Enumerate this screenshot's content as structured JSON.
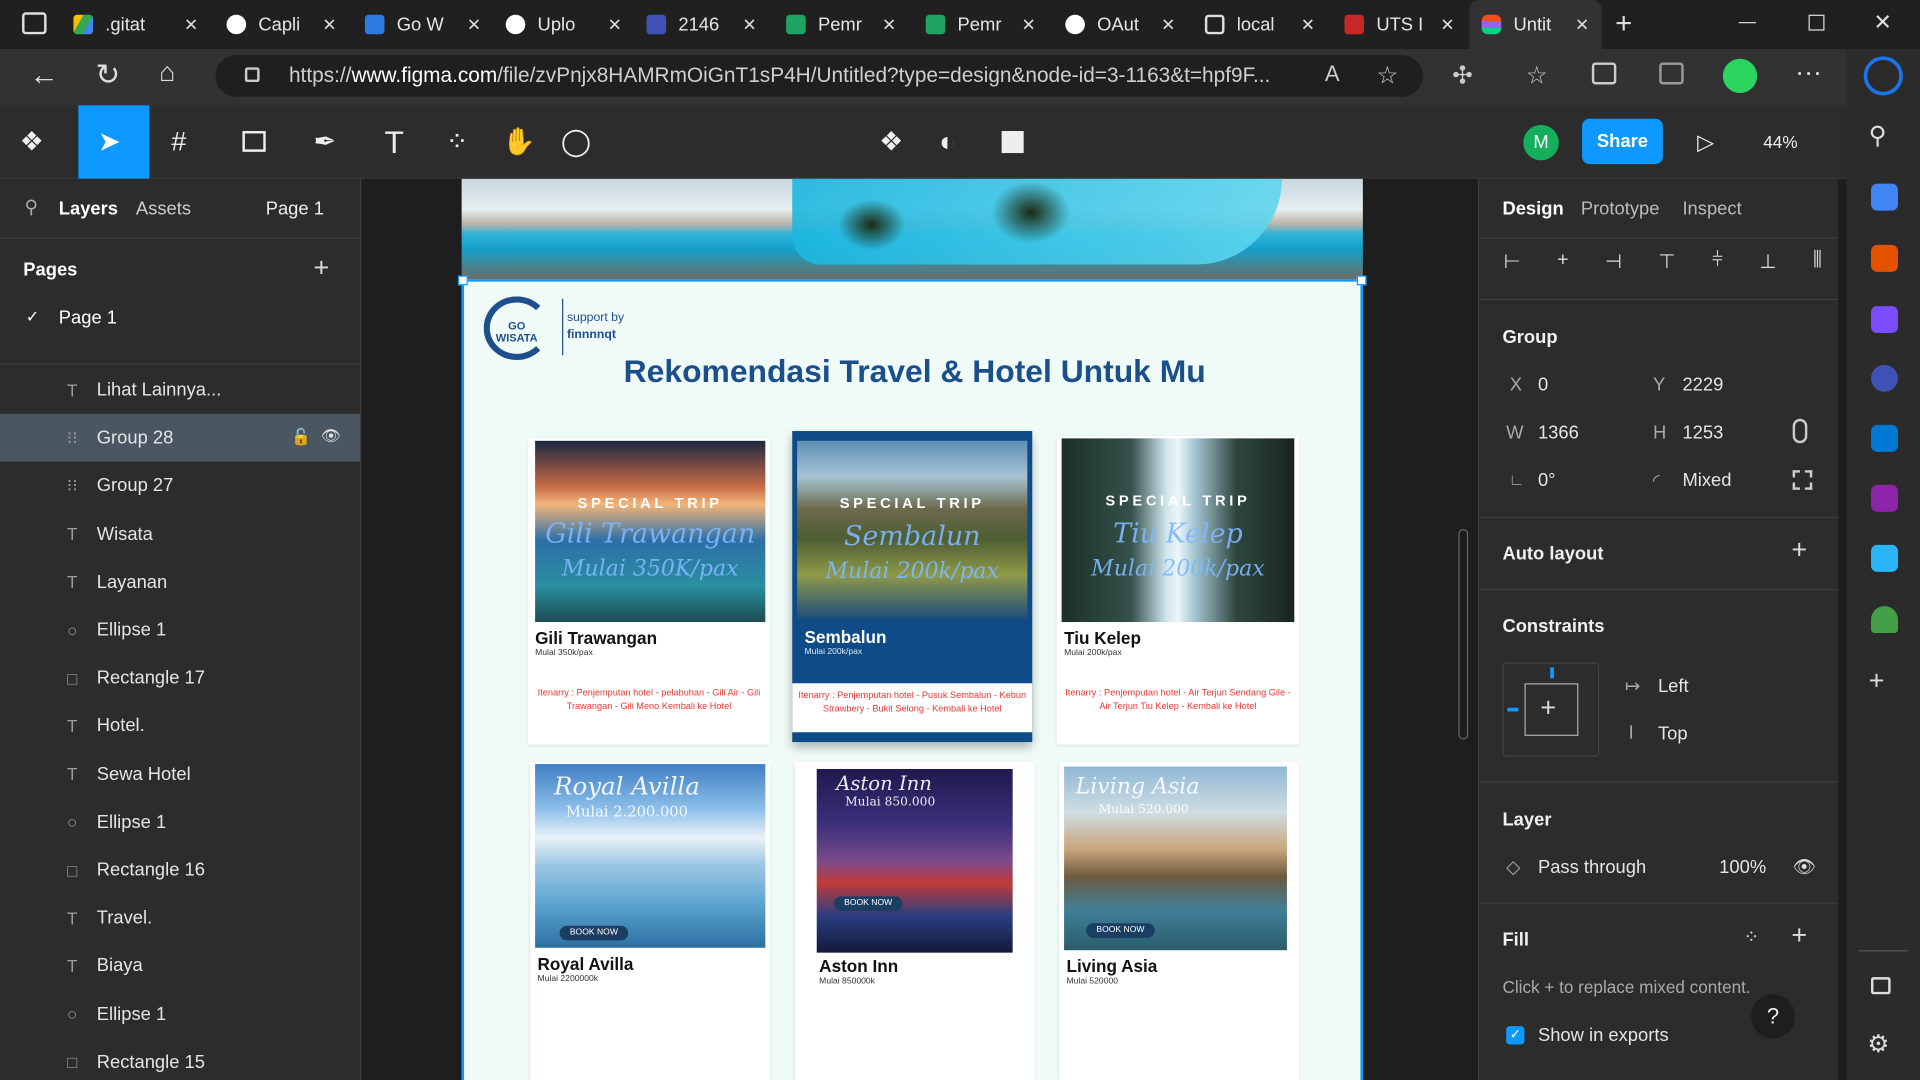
{
  "browser": {
    "tabs": [
      {
        "label": ".gitat"
      },
      {
        "label": "Capli"
      },
      {
        "label": "Go W"
      },
      {
        "label": "Uplo"
      },
      {
        "label": "2146"
      },
      {
        "label": "Pemr"
      },
      {
        "label": "Pemr"
      },
      {
        "label": "OAut"
      },
      {
        "label": "local"
      },
      {
        "label": "UTS I"
      },
      {
        "label": "Untit"
      }
    ],
    "url_prefix": "https://",
    "url_domain": "www.figma.com",
    "url_path": "/file/zvPnjx8HAMRmOiGnT1sP4H/Untitled?type=design&node-id=3-1163&t=hpf9F..."
  },
  "figma": {
    "avatar_initial": "M",
    "share_label": "Share",
    "zoom": "44%"
  },
  "left_panel": {
    "tab_layers": "Layers",
    "tab_assets": "Assets",
    "page_selector": "Page 1",
    "pages_heading": "Pages",
    "pages": [
      "Page 1"
    ],
    "layers": [
      {
        "icon": "T",
        "name": "Lihat Lainnya..."
      },
      {
        "icon": "#",
        "name": "Group 28"
      },
      {
        "icon": "#",
        "name": "Group 27"
      },
      {
        "icon": "T",
        "name": "Wisata"
      },
      {
        "icon": "T",
        "name": "Layanan"
      },
      {
        "icon": "O",
        "name": "Ellipse 1"
      },
      {
        "icon": "R",
        "name": "Rectangle 17"
      },
      {
        "icon": "T",
        "name": "Hotel."
      },
      {
        "icon": "T",
        "name": "Sewa Hotel"
      },
      {
        "icon": "O",
        "name": "Ellipse 1"
      },
      {
        "icon": "R",
        "name": "Rectangle 16"
      },
      {
        "icon": "T",
        "name": "Travel."
      },
      {
        "icon": "T",
        "name": "Biaya"
      },
      {
        "icon": "O",
        "name": "Ellipse 1"
      },
      {
        "icon": "R",
        "name": "Rectangle 15"
      }
    ]
  },
  "right_panel": {
    "tabs": [
      "Design",
      "Prototype",
      "Inspect"
    ],
    "group_label": "Group",
    "x_label": "X",
    "x": "0",
    "y_label": "Y",
    "y": "2229",
    "w_label": "W",
    "w": "1366",
    "h_label": "H",
    "h": "1253",
    "rotation": "0°",
    "radius": "Mixed",
    "auto_layout": "Auto layout",
    "constraints": "Constraints",
    "constraint_h": "Left",
    "constraint_v": "Top",
    "layer": "Layer",
    "blend": "Pass through",
    "opacity": "100%",
    "fill": "Fill",
    "fill_hint": "Click + to replace mixed content.",
    "show_exports": "Show in exports"
  },
  "design": {
    "logo_text": "GO WISATA",
    "support_by": "support by",
    "support_name": "finnnnqt",
    "heading": "Rekomendasi Travel & Hotel Untuk Mu",
    "special_trip": "SPECIAL TRIP",
    "travel_cards": [
      {
        "title": "Gili Trawangan",
        "price": "Mulai 350k/pax",
        "script1": "Gili Trawangan",
        "script2": "Mulai 350K/pax",
        "itinerary": "Itenarry : Penjemputan hotel - pelabuhan - Gili Air - Gili Trawangan - Gili Meno Kembali ke Hotel"
      },
      {
        "title": "Sembalun",
        "price": "Mulai 200k/pax",
        "script1": "Sembalun",
        "script2": "Mulai 200k/pax",
        "itinerary": "Itenarry : Penjemputan hotel - Pusuk Sembalun - Kebun Strawbery - Bukit Selong - Kembali ke Hotel"
      },
      {
        "title": "Tiu Kelep",
        "price": "Mulai 200k/pax",
        "script1": "Tiu Kelep",
        "script2": "Mulai 200k/pax",
        "itinerary": "Itenarry : Penjemputan hotel - Air Terjun Sendang Gile - Air Terjun Tiu Kelep - Kembali ke Hotel"
      }
    ],
    "hotel_cards": [
      {
        "title": "Royal Avilla",
        "price": "Mulai 2200000k",
        "script1": "Royal Avilla",
        "script2": "Mulai 2.200.000",
        "book": "BOOK NOW"
      },
      {
        "title": "Aston Inn",
        "price": "Mulai 850000k",
        "script1": "Aston Inn",
        "script2": "Mulai 850.000",
        "book": "BOOK NOW"
      },
      {
        "title": "Living Asia",
        "price": "Mulai 520000",
        "script1": "Living Asia",
        "script2": "Mulai 520.000",
        "book": "BOOK NOW"
      }
    ]
  },
  "colors": {
    "accent": "#0d99ff",
    "heading": "#1a4f8b",
    "itinerary": "#e53935",
    "selected_layer": "#4b5663"
  }
}
